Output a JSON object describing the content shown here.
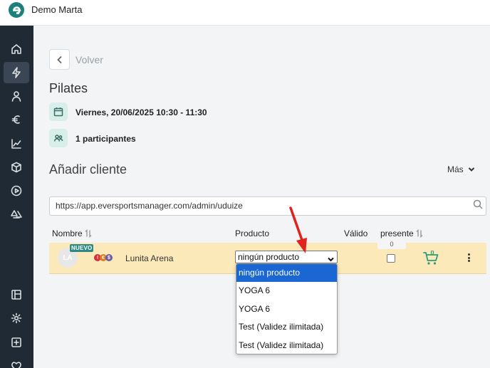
{
  "app": {
    "company_name": "Demo Marta"
  },
  "sidebar": {
    "items": [
      {
        "name": "home-icon",
        "active": false
      },
      {
        "name": "lightning-icon",
        "active": true
      },
      {
        "name": "user-icon",
        "active": false
      },
      {
        "name": "euro-icon",
        "active": false
      },
      {
        "name": "chart-icon",
        "active": false
      },
      {
        "name": "box-icon",
        "active": false
      },
      {
        "name": "play-icon",
        "active": false
      },
      {
        "name": "shapes-icon",
        "active": false
      },
      {
        "name": "layout-icon",
        "active": false
      },
      {
        "name": "gear-icon",
        "active": false
      },
      {
        "name": "plus-square-icon",
        "active": false
      },
      {
        "name": "heart-icon",
        "active": false
      }
    ]
  },
  "header": {
    "back_label": "Volver",
    "title": "Pilates"
  },
  "event": {
    "datetime": "Viernes, 20/06/2025 10:30 - 11:30",
    "participants": "1 participantes"
  },
  "add_client": {
    "title": "Añadir cliente",
    "more_label": "Más",
    "search_value": "https://app.eversportsmanager.com/admin/uduize"
  },
  "table": {
    "headers": {
      "name": "Nombre",
      "product": "Producto",
      "valid": "Válido",
      "present": "presente"
    },
    "row": {
      "initials": "LA",
      "badge": "NUEVO",
      "name": "Lunita Arena",
      "product_selected": "ningún producto",
      "present_count": "0",
      "cart_count": "0",
      "dot_labels": [
        "!",
        "€",
        "$"
      ]
    }
  },
  "dropdown": {
    "options": [
      "ningún producto",
      "YOGA 6",
      "YOGA 6",
      "Test (Validez ilimitada)",
      "Test (Validez ilimitada)"
    ],
    "selected_index": 0
  },
  "colors": {
    "accent": "#2c8a83",
    "row_highlight": "#fbe9b9",
    "sidebar_bg": "#1f2a35",
    "annotation_arrow": "#e0231c",
    "select_highlight": "#1a66d2"
  }
}
